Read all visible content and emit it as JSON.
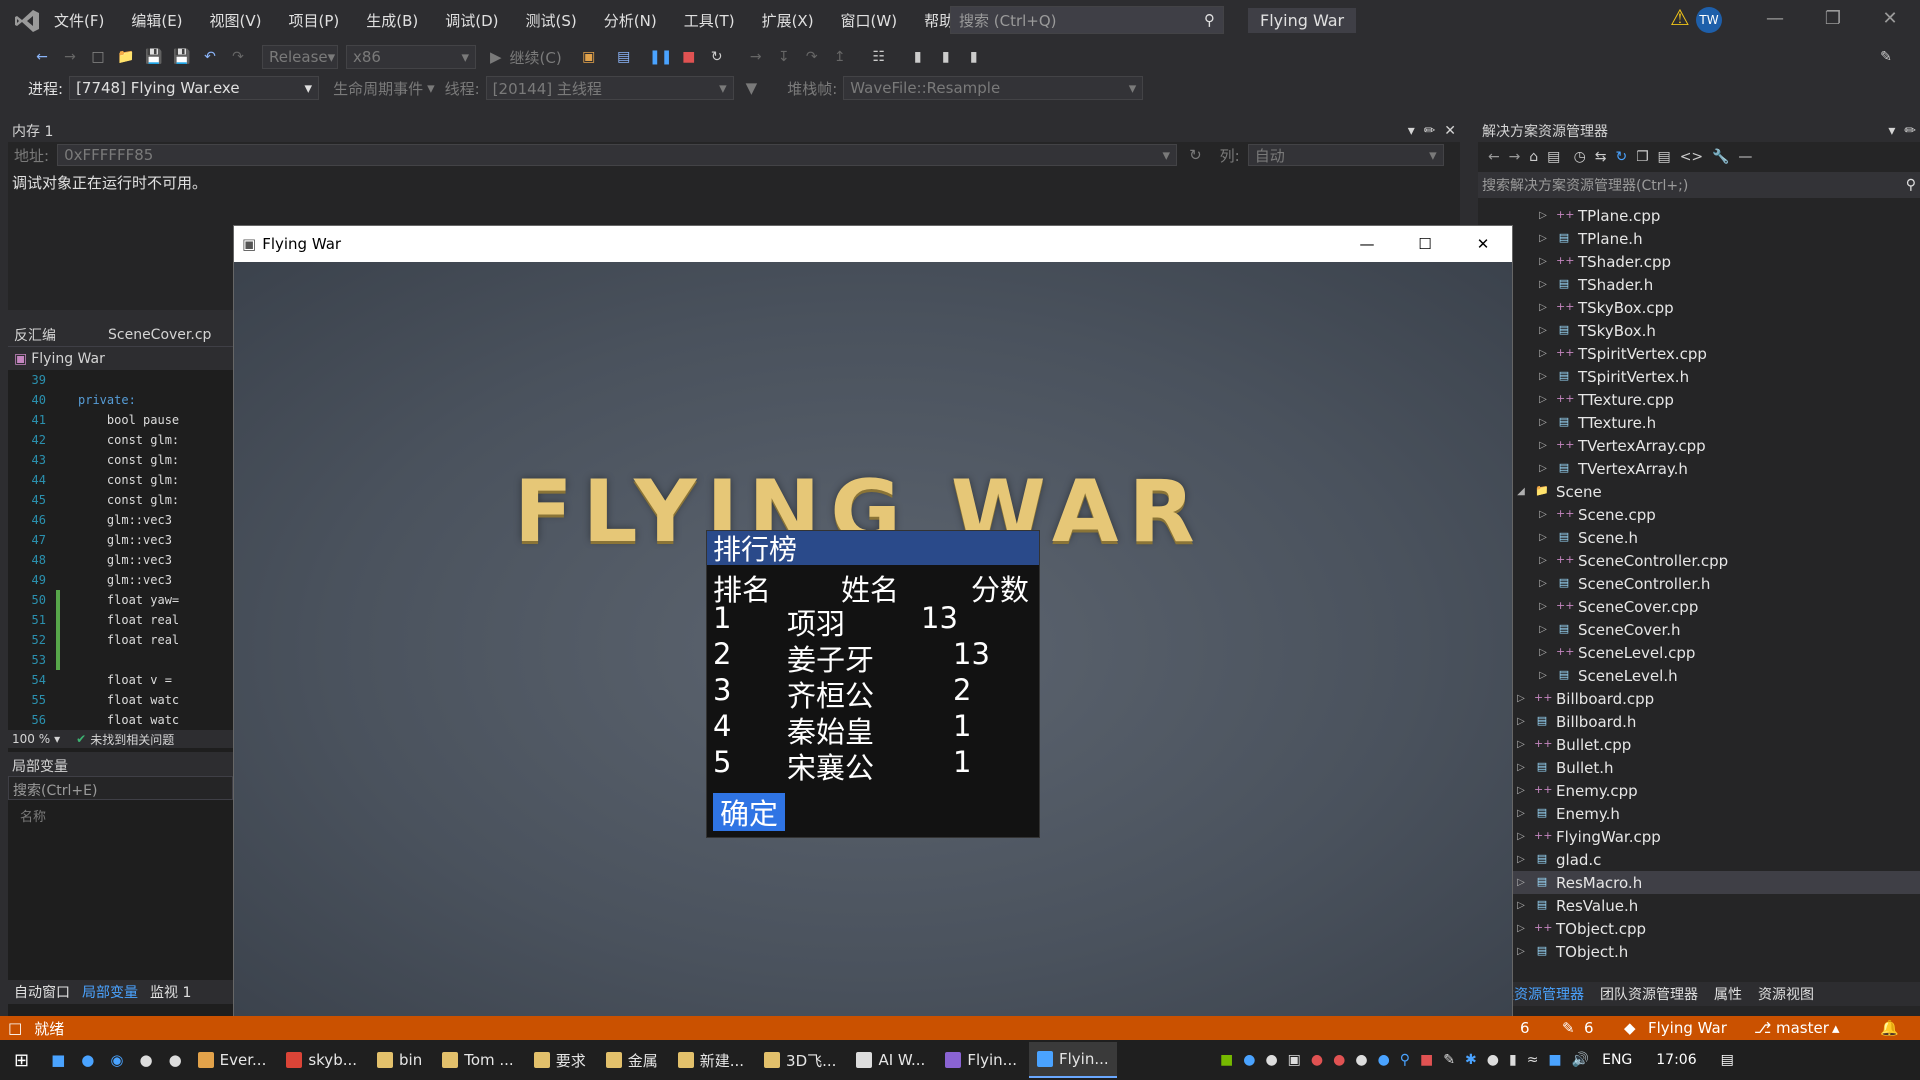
{
  "menu": [
    "文件(F)",
    "编辑(E)",
    "视图(V)",
    "项目(P)",
    "生成(B)",
    "调试(D)",
    "测试(S)",
    "分析(N)",
    "工具(T)",
    "扩展(X)",
    "窗口(W)",
    "帮助(H)"
  ],
  "search_placeholder": "搜索 (Ctrl+Q)",
  "solution_title": "Flying War",
  "avatar_initials": "TW",
  "toolbar": {
    "config": "Release",
    "platform": "x86",
    "continue": "继续(C)"
  },
  "debugbar": {
    "process_label": "进程:",
    "process_value": "[7748] Flying War.exe",
    "lifecycle": "生命周期事件",
    "thread_label": "线程:",
    "thread_value": "[20144] 主线程",
    "stack_label": "堆栈帧:",
    "stack_value": "WaveFile::Resample"
  },
  "memory_panel": {
    "title": "内存 1",
    "address_label": "地址:",
    "address_value": "0xFFFFFF85",
    "column_label": "列:",
    "column_value": "自动",
    "message": "调试对象正在运行时不可用。"
  },
  "editor": {
    "tab_disasm": "反汇编",
    "tab_file": "SceneCover.cp",
    "context": "Flying War",
    "lines": [
      {
        "n": "39",
        "code": ""
      },
      {
        "n": "40",
        "code": "private:"
      },
      {
        "n": "41",
        "code": "    bool pause"
      },
      {
        "n": "42",
        "code": "    const glm:"
      },
      {
        "n": "43",
        "code": "    const glm:"
      },
      {
        "n": "44",
        "code": "    const glm:"
      },
      {
        "n": "45",
        "code": "    const glm:"
      },
      {
        "n": "46",
        "code": "    glm::vec3 "
      },
      {
        "n": "47",
        "code": "    glm::vec3 "
      },
      {
        "n": "48",
        "code": "    glm::vec3 "
      },
      {
        "n": "49",
        "code": "    glm::vec3 "
      },
      {
        "n": "50",
        "code": "    float yaw="
      },
      {
        "n": "51",
        "code": "    float real"
      },
      {
        "n": "52",
        "code": "    float real"
      },
      {
        "n": "53",
        "code": ""
      },
      {
        "n": "54",
        "code": "    float v = "
      },
      {
        "n": "55",
        "code": "    float watc"
      },
      {
        "n": "56",
        "code": "    float watc"
      }
    ],
    "zoom": "100 %",
    "issues": "未找到相关问题"
  },
  "locals": {
    "title": "局部变量",
    "search": "搜索(Ctrl+E)",
    "name_col": "名称",
    "tabs": [
      "自动窗口",
      "局部变量",
      "监视 1"
    ]
  },
  "solution_explorer": {
    "title": "解决方案资源管理器",
    "search": "搜索解决方案资源管理器(Ctrl+;)",
    "items": [
      {
        "name": "TPlane.cpp",
        "type": "cpp",
        "level": 2
      },
      {
        "name": "TPlane.h",
        "type": "h",
        "level": 2
      },
      {
        "name": "TShader.cpp",
        "type": "cpp",
        "level": 2
      },
      {
        "name": "TShader.h",
        "type": "h",
        "level": 2
      },
      {
        "name": "TSkyBox.cpp",
        "type": "cpp",
        "level": 2
      },
      {
        "name": "TSkyBox.h",
        "type": "h",
        "level": 2
      },
      {
        "name": "TSpiritVertex.cpp",
        "type": "cpp",
        "level": 2
      },
      {
        "name": "TSpiritVertex.h",
        "type": "h",
        "level": 2
      },
      {
        "name": "TTexture.cpp",
        "type": "cpp",
        "level": 2
      },
      {
        "name": "TTexture.h",
        "type": "h",
        "level": 2
      },
      {
        "name": "TVertexArray.cpp",
        "type": "cpp",
        "level": 2
      },
      {
        "name": "TVertexArray.h",
        "type": "h",
        "level": 2
      },
      {
        "name": "Scene",
        "type": "folder",
        "level": 1
      },
      {
        "name": "Scene.cpp",
        "type": "cpp",
        "level": 2
      },
      {
        "name": "Scene.h",
        "type": "h",
        "level": 2
      },
      {
        "name": "SceneController.cpp",
        "type": "cpp",
        "level": 2
      },
      {
        "name": "SceneController.h",
        "type": "h",
        "level": 2
      },
      {
        "name": "SceneCover.cpp",
        "type": "cpp",
        "level": 2
      },
      {
        "name": "SceneCover.h",
        "type": "h",
        "level": 2
      },
      {
        "name": "SceneLevel.cpp",
        "type": "cpp",
        "level": 2
      },
      {
        "name": "SceneLevel.h",
        "type": "h",
        "level": 2
      },
      {
        "name": "Billboard.cpp",
        "type": "cpp",
        "level": 1
      },
      {
        "name": "Billboard.h",
        "type": "h",
        "level": 1
      },
      {
        "name": "Bullet.cpp",
        "type": "cpp",
        "level": 1
      },
      {
        "name": "Bullet.h",
        "type": "h",
        "level": 1
      },
      {
        "name": "Enemy.cpp",
        "type": "cpp",
        "level": 1
      },
      {
        "name": "Enemy.h",
        "type": "h",
        "level": 1
      },
      {
        "name": "FlyingWar.cpp",
        "type": "cpp",
        "level": 1
      },
      {
        "name": "glad.c",
        "type": "h",
        "level": 1
      },
      {
        "name": "ResMacro.h",
        "type": "h",
        "level": 1,
        "selected": true
      },
      {
        "name": "ResValue.h",
        "type": "h",
        "level": 1
      },
      {
        "name": "TObject.cpp",
        "type": "cpp",
        "level": 1
      },
      {
        "name": "TObject.h",
        "type": "h",
        "level": 1
      }
    ],
    "bottom_tabs": [
      "方案资源管理器",
      "团队资源管理器",
      "属性",
      "资源视图"
    ]
  },
  "game_window": {
    "title": "Flying War",
    "game_title": "FLYING WAR",
    "leaderboard": {
      "title": "排行榜",
      "columns": [
        "排名",
        "姓名",
        "分数"
      ],
      "rows": [
        {
          "rank": "1",
          "name": "项羽",
          "score": "13"
        },
        {
          "rank": "2",
          "name": "姜子牙",
          "score": "13"
        },
        {
          "rank": "3",
          "name": "齐桓公",
          "score": "2"
        },
        {
          "rank": "4",
          "name": "秦始皇",
          "score": "1"
        },
        {
          "rank": "5",
          "name": "宋襄公",
          "score": "1"
        }
      ],
      "ok_button": "确定"
    }
  },
  "statusbar": {
    "ready": "就绪",
    "errors": "6",
    "changes": "6",
    "repo": "Flying War",
    "branch": "master"
  },
  "taskbar": {
    "tasks": [
      "Ever...",
      "skyb...",
      "bin",
      "Tom ...",
      "要求",
      "金属",
      "新建...",
      "3D飞...",
      "AI W...",
      "Flyin...",
      "Flyin..."
    ],
    "lang": "ENG",
    "time": "17:06"
  }
}
